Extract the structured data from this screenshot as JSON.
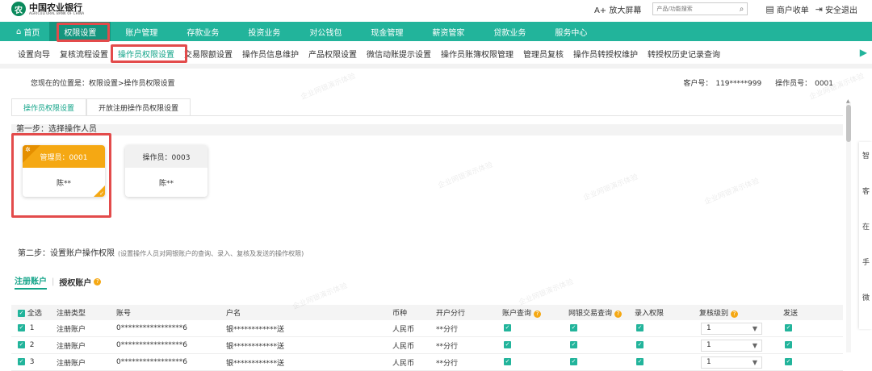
{
  "brand": {
    "mark": "农",
    "name_cn": "中国农业银行",
    "name_en": "AGRICULTURAL BANK OF CHINA"
  },
  "topbar": {
    "zoom_label": "A+ 放大屏幕",
    "search_placeholder": "产品/功能搜索",
    "cashier_label": "商户收单",
    "logout_label": "安全退出"
  },
  "mainnav": {
    "items": [
      "首页",
      "权限设置",
      "账户管理",
      "存款业务",
      "投资业务",
      "对公钱包",
      "现金管理",
      "薪资管家",
      "贷款业务",
      "服务中心"
    ],
    "active": "权限设置"
  },
  "subnav": {
    "items": [
      "设置向导",
      "复核流程设置",
      "操作员权限设置",
      "交易限额设置",
      "操作员信息维护",
      "产品权限设置",
      "微信动账提示设置",
      "操作员账簿权限管理",
      "管理员复核",
      "操作员转授权维护",
      "转授权历史记录查询"
    ],
    "active": "操作员权限设置"
  },
  "breadcrumb": "您现在的位置是：权限设置>操作员权限设置",
  "account": {
    "customer_label": "客户号：",
    "customer_no": "119*****999",
    "operator_label": "操作员号：",
    "operator_no": "0001"
  },
  "tabs": [
    "操作员权限设置",
    "开放注册操作员权限设置"
  ],
  "step1": {
    "title": "第一步：选择操作人员"
  },
  "operators": [
    {
      "role": "管理员：0001",
      "name": "陈**",
      "selected": true
    },
    {
      "role": "操作员：0003",
      "name": "陈**",
      "selected": false
    }
  ],
  "step2": {
    "title": "第二步：设置账户操作权限",
    "note": "(设置操作人员对网银账户的查询、录入、复核及发送的操作权限)"
  },
  "account_tabs": [
    "注册账户",
    "授权账户"
  ],
  "table": {
    "headers": [
      "全选",
      "注册类型",
      "账号",
      "户名",
      "币种",
      "开户分行",
      "账户查询",
      "网银交易查询",
      "录入权限",
      "复核级别",
      "发送"
    ],
    "rows": [
      {
        "no": "1",
        "type": "注册账户",
        "account": "0*****************6",
        "name": "银************送",
        "currency": "人民币",
        "branch": "**分行",
        "level": "1"
      },
      {
        "no": "2",
        "type": "注册账户",
        "account": "0*****************6",
        "name": "银************送",
        "currency": "人民币",
        "branch": "**分行",
        "level": "1"
      },
      {
        "no": "3",
        "type": "注册账户",
        "account": "0*****************6",
        "name": "银************送",
        "currency": "人民币",
        "branch": "**分行",
        "level": "1"
      }
    ]
  },
  "watermark": "企业网银演示体验",
  "colors": {
    "primary": "#22b49b",
    "accent": "#f5a813",
    "highlight": "#e34b4b"
  },
  "sidepanel": [
    "智",
    "客",
    "在",
    "手",
    "微"
  ]
}
